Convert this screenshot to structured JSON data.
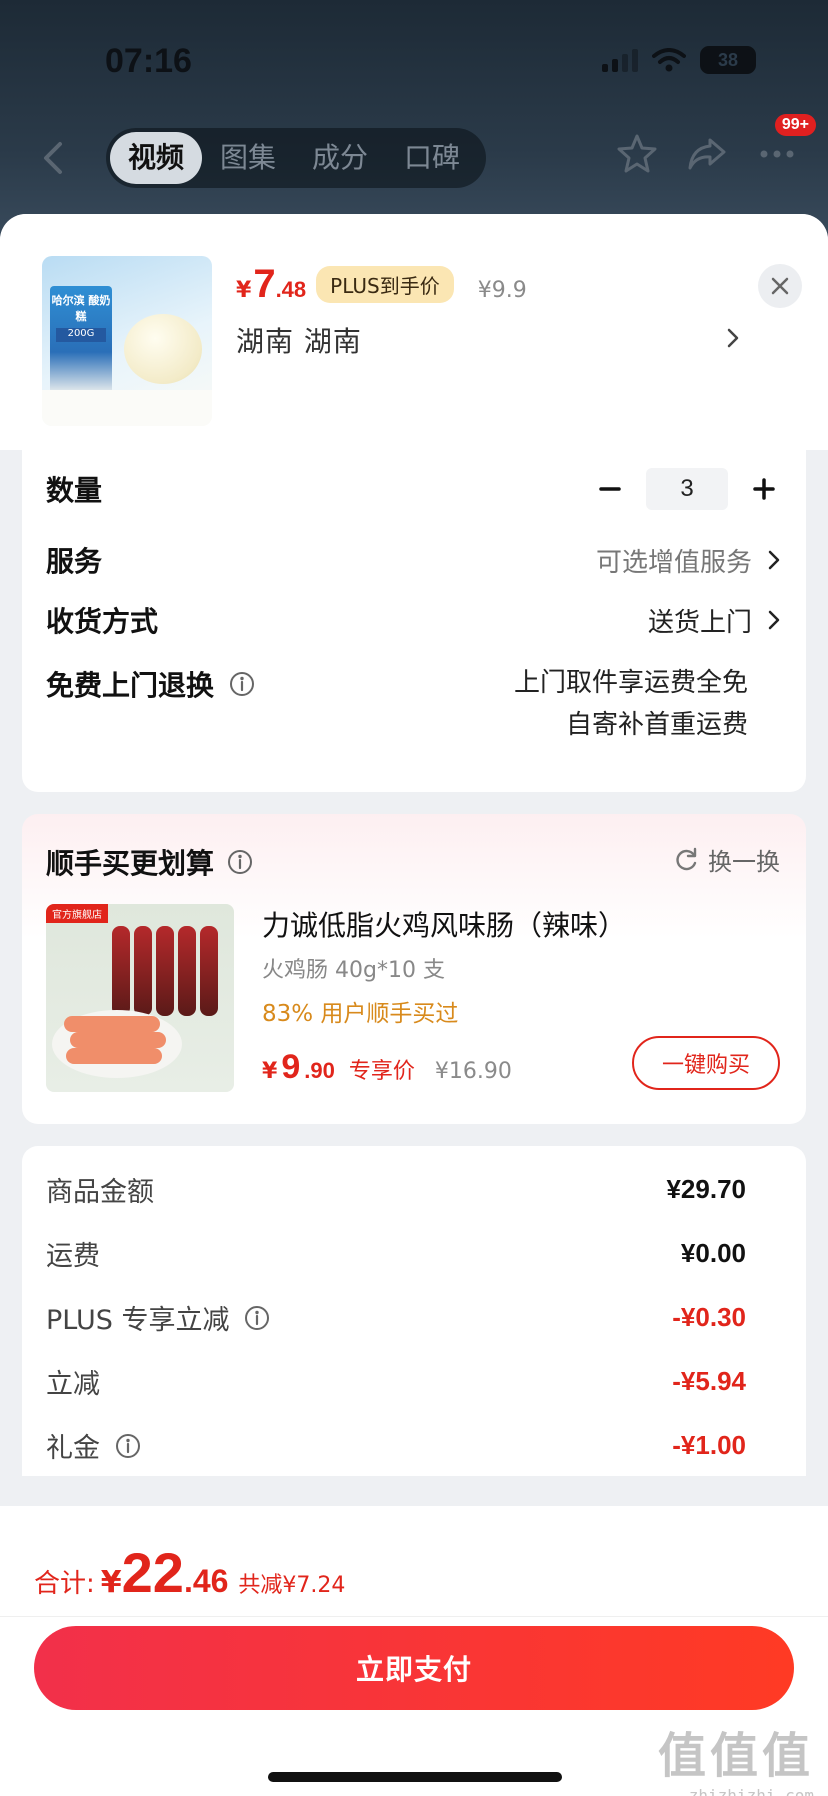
{
  "status_bar": {
    "time": "07:16",
    "battery": "38"
  },
  "nav": {
    "tabs": [
      {
        "label": "视频"
      },
      {
        "label": "图集"
      },
      {
        "label": "成分"
      },
      {
        "label": "口碑"
      }
    ],
    "badge": "99+"
  },
  "product": {
    "price_currency": "¥",
    "price_int": "7",
    "price_dec": ".48",
    "plus_tag": "PLUS到手价",
    "original_price": "¥9.9",
    "spec": "湖南  湖南",
    "thumb_brand": "哈尔滨\n酸奶糕",
    "thumb_weight": "200G"
  },
  "options": {
    "quantity_label": "数量",
    "quantity_value": "3",
    "service_label": "服务",
    "service_value": "可选增值服务",
    "delivery_label": "收货方式",
    "delivery_value": "送货上门",
    "return_label": "免费上门退换",
    "return_line1": "上门取件享运费全免",
    "return_line2": "自寄补首重运费"
  },
  "upsell": {
    "title": "顺手买更划算",
    "refresh_label": "换一换",
    "store_tag": "官方旗舰店",
    "name": "力诚低脂火鸡风味肠（辣味）",
    "spec": "火鸡肠 40g*10 支",
    "stat": "83% 用户顺手买过",
    "price_currency": "¥",
    "price_int": "9",
    "price_dec": ".90",
    "price_tag": "专享价",
    "original_price": "¥16.90",
    "buy_label": "一键购买"
  },
  "summary": {
    "rows": [
      {
        "label": "商品金额",
        "value": "¥29.70"
      },
      {
        "label": "运费",
        "value": "¥0.00"
      },
      {
        "label": "PLUS 专享立减",
        "value": "-¥0.30"
      },
      {
        "label": "立减",
        "value": "-¥5.94"
      },
      {
        "label": "礼金",
        "value": "-¥1.00"
      }
    ]
  },
  "bottom": {
    "total_label": "合计:",
    "total_currency": "¥",
    "total_int": "22",
    "total_dec": ".46",
    "total_saved": "共减¥7.24",
    "pay_label": "立即支付"
  },
  "watermark": {
    "logo": "值值值",
    "url": "zhizhizhi.com"
  },
  "colors": {
    "accent_red": "#e1251b",
    "plus_gold": "#fbe6b3",
    "stat_orange": "#d88a1c"
  }
}
